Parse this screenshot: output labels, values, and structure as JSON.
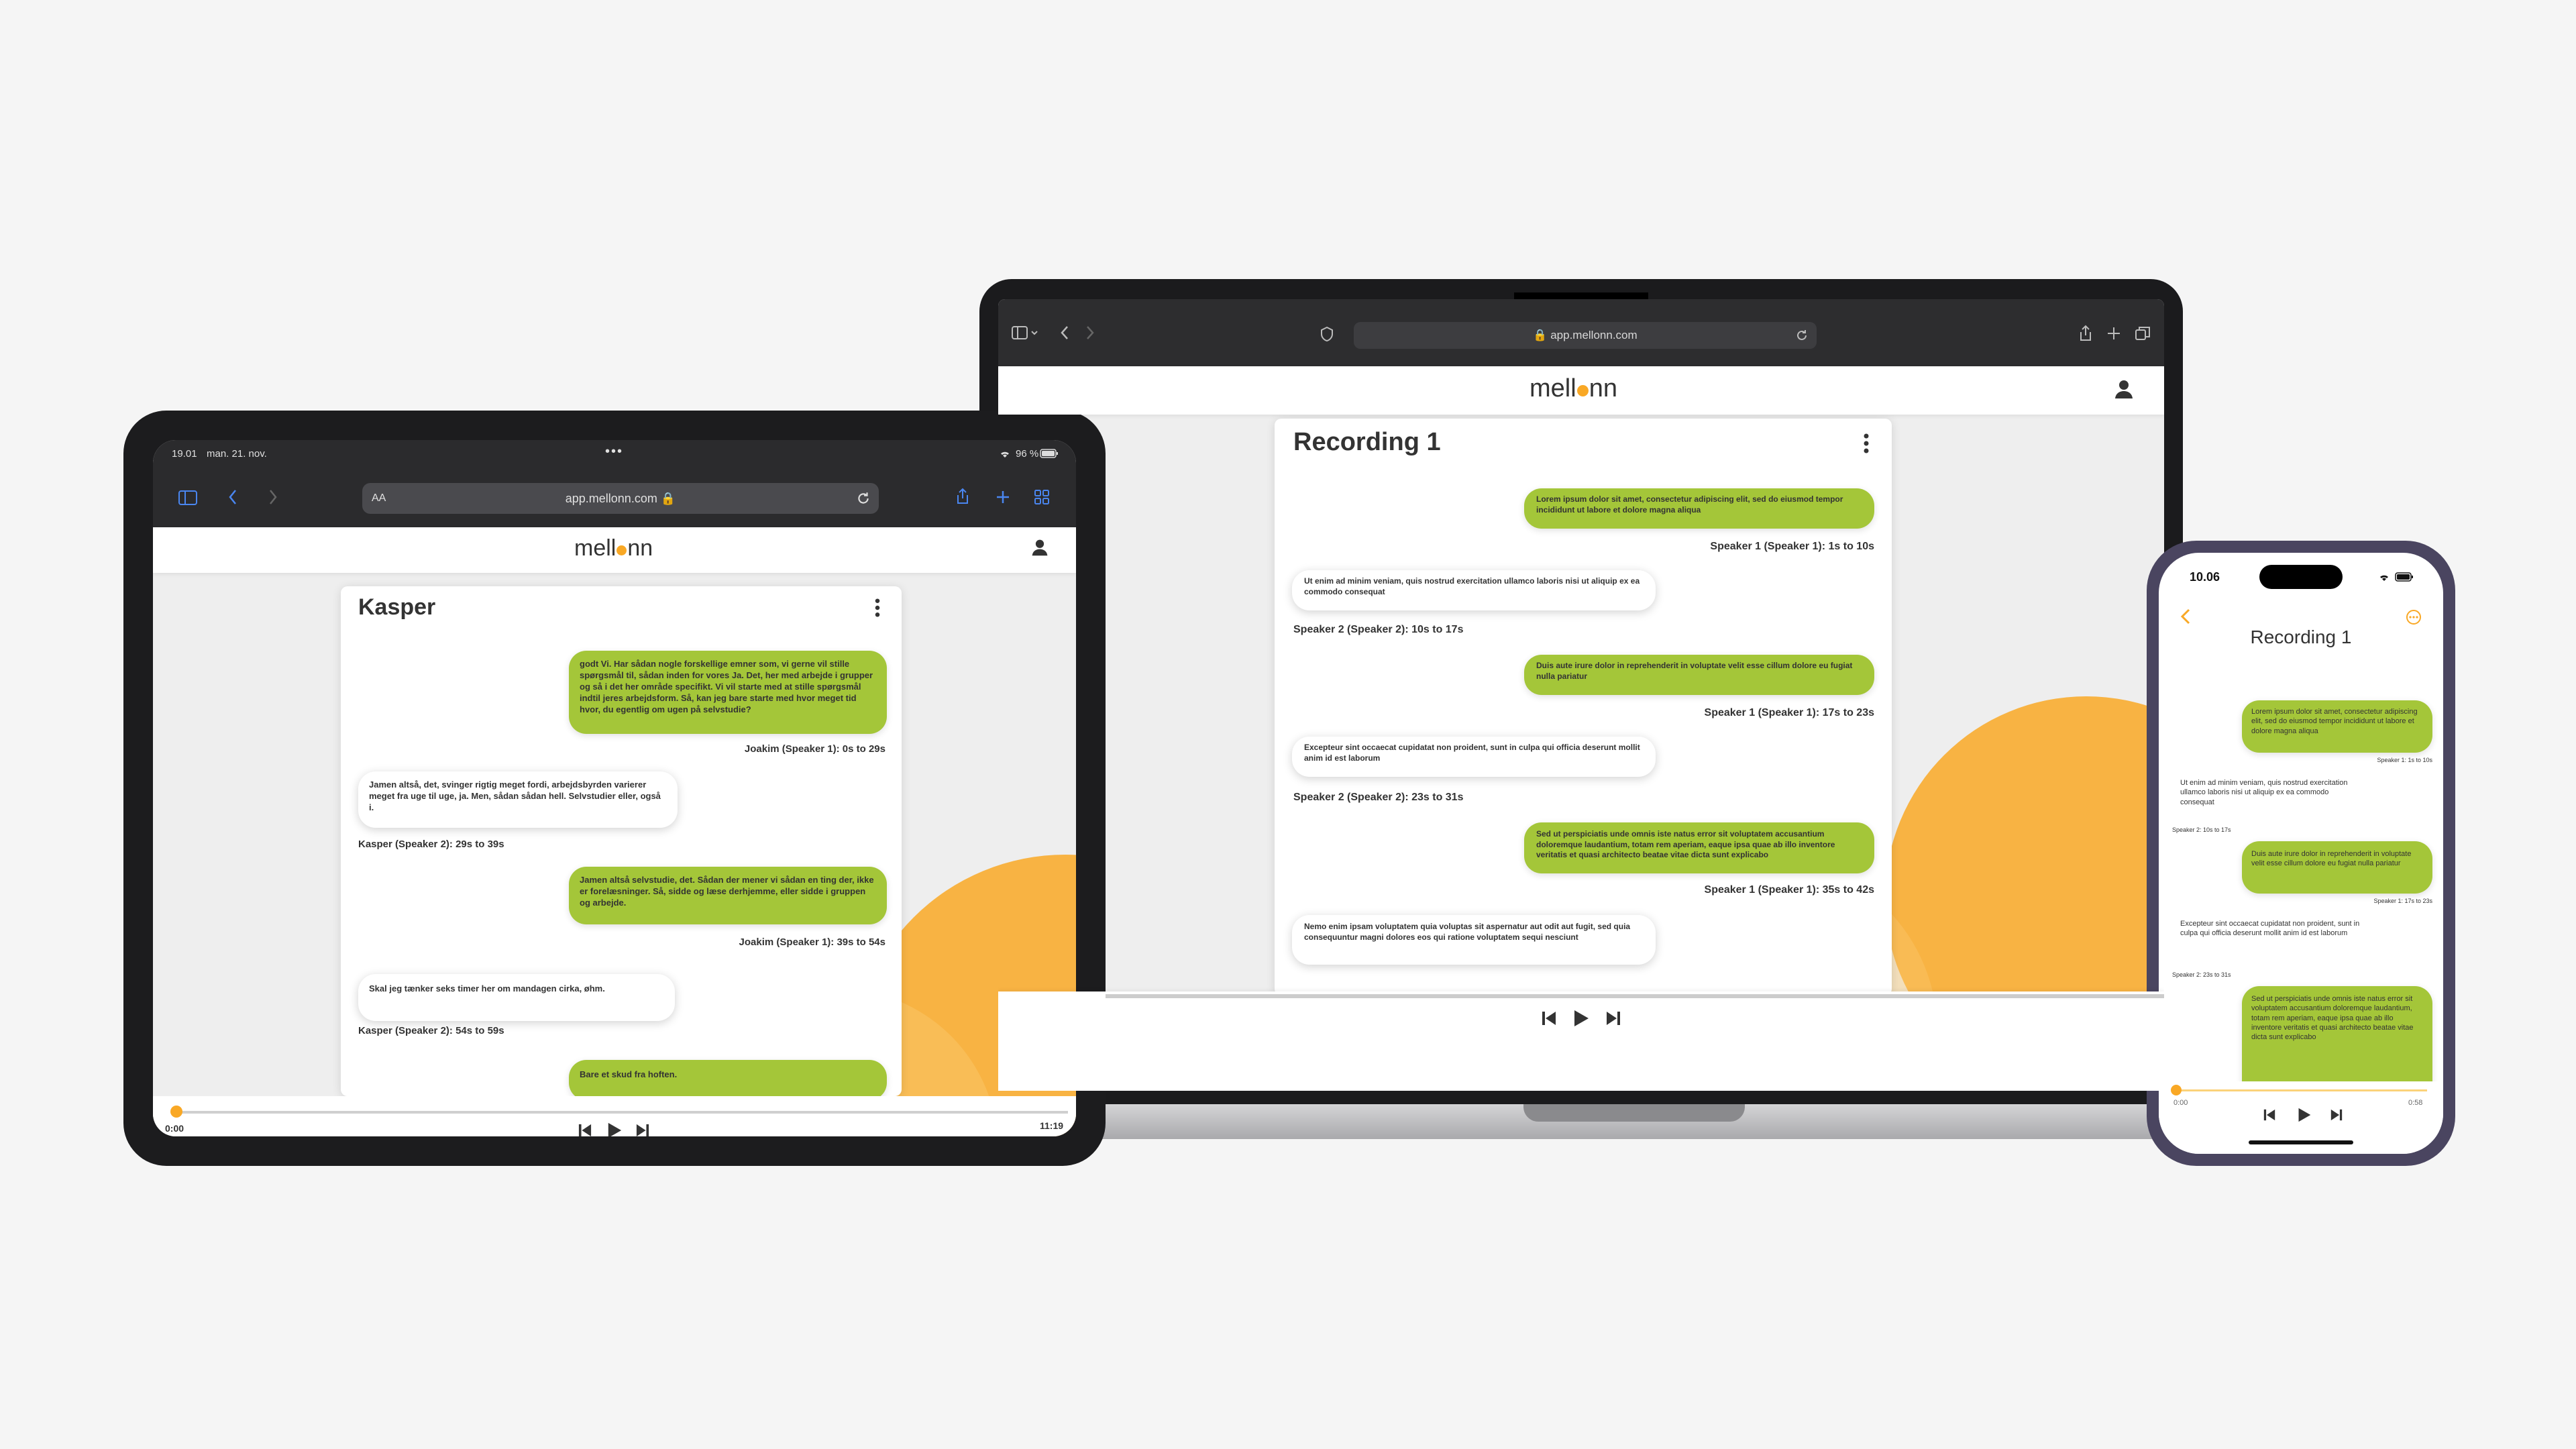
{
  "brand": {
    "name_prefix": "mell",
    "name_suffix": "nn",
    "green": "#a4c639",
    "orange": "#f9a825",
    "dark": "#333333"
  },
  "laptop": {
    "url": "app.mellonn.com",
    "title": "Recording 1",
    "messages": [
      {
        "side": "right",
        "text": "Lorem ipsum dolor sit amet, consectetur adipiscing elit, sed do eiusmod tempor incididunt ut labore et dolore magna aliqua",
        "speaker": "Speaker 1 (Speaker 1): 1s to 10s"
      },
      {
        "side": "left",
        "text": "Ut enim ad minim veniam, quis nostrud exercitation ullamco laboris nisi ut aliquip ex ea commodo consequat",
        "speaker": "Speaker 2 (Speaker 2): 10s to 17s"
      },
      {
        "side": "right",
        "text": "Duis aute irure dolor in reprehenderit in voluptate velit esse cillum dolore eu fugiat nulla pariatur",
        "speaker": "Speaker 1 (Speaker 1): 17s to 23s"
      },
      {
        "side": "left",
        "text": "Excepteur sint occaecat cupidatat non proident, sunt in culpa qui officia deserunt mollit anim id est laborum",
        "speaker": "Speaker 2 (Speaker 2): 23s to 31s"
      },
      {
        "side": "right",
        "text": "Sed ut perspiciatis unde omnis iste natus error sit voluptatem accusantium doloremque laudantium, totam rem aperiam, eaque ipsa quae ab illo inventore veritatis et quasi architecto beatae vitae dicta sunt explicabo",
        "speaker": "Speaker 1 (Speaker 1): 35s to 42s"
      },
      {
        "side": "left",
        "text": "Nemo enim ipsam voluptatem quia voluptas sit aspernatur aut odit aut fugit, sed quia consequuntur magni dolores eos qui ratione voluptatem sequi nesciunt",
        "speaker": ""
      }
    ]
  },
  "tablet": {
    "time": "19.01",
    "date": "man. 21. nov.",
    "battery": "96 %",
    "text_size": "AA",
    "url": "app.mellonn.com",
    "title": "Kasper",
    "messages": [
      {
        "side": "right",
        "text": "godt Vi. Har sådan nogle forskellige emner som, vi gerne vil stille spørgsmål til, sådan inden for vores Ja. Det, her med arbejde i grupper og så i det her område specifikt. Vi vil starte med at stille spørgsmål indtil jeres arbejdsform. Så, kan jeg bare starte med hvor meget tid hvor, du egentlig om ugen på selvstudie?",
        "speaker": "Joakim (Speaker 1): 0s to 29s"
      },
      {
        "side": "left",
        "text": "Jamen altså, det, svinger rigtig meget fordi, arbejdsbyrden varierer meget fra uge til uge, ja. Men, sådan sådan hell. Selvstudier eller, også i.",
        "speaker": "Kasper (Speaker 2): 29s to 39s"
      },
      {
        "side": "right",
        "text": "Jamen altså selvstudie, det. Sådan der mener vi sådan en ting der, ikke er forelæsninger. Så, sidde og læse derhjemme, eller sidde i gruppen og arbejde.",
        "speaker": "Joakim (Speaker 1): 39s to 54s"
      },
      {
        "side": "left",
        "text": "Skal jeg tænker seks timer her om mandagen cirka, øhm.",
        "speaker": "Kasper (Speaker 2): 54s to 59s"
      },
      {
        "side": "right",
        "text": "Bare et skud fra hoften.",
        "speaker": ""
      }
    ],
    "player": {
      "current": "0:00",
      "total": "11:19",
      "progress": 0.0
    }
  },
  "phone": {
    "time": "10.06",
    "title": "Recording 1",
    "messages": [
      {
        "side": "right",
        "text": "Lorem ipsum dolor sit amet, consectetur adipiscing elit, sed do eiusmod tempor incididunt ut labore et dolore magna aliqua",
        "speaker": "Speaker 1: 1s to 10s"
      },
      {
        "side": "left",
        "text": "Ut enim ad minim veniam, quis nostrud exercitation ullamco laboris nisi ut aliquip ex ea commodo consequat",
        "speaker": "Speaker 2: 10s to 17s"
      },
      {
        "side": "right",
        "text": "Duis aute irure dolor in reprehenderit in voluptate velit esse cillum dolore eu fugiat nulla pariatur",
        "speaker": "Speaker 1: 17s to 23s"
      },
      {
        "side": "left",
        "text": "Excepteur sint occaecat cupidatat non proident, sunt in culpa qui officia deserunt mollit anim id est laborum",
        "speaker": "Speaker 2: 23s to 31s"
      },
      {
        "side": "right",
        "text": "Sed ut perspiciatis unde omnis iste natus error sit voluptatem accusantium doloremque laudantium, totam rem aperiam, eaque ipsa quae ab illo inventore veritatis et quasi architecto beatae vitae dicta sunt explicabo",
        "speaker": ""
      }
    ],
    "player": {
      "current": "0:00",
      "total": "0:58",
      "progress": 0.0
    }
  },
  "icons": [
    "sidebar-icon",
    "back-icon",
    "forward-icon",
    "share-icon",
    "plus-icon",
    "tabs-icon",
    "reload-icon",
    "user-icon",
    "more-vertical-icon",
    "skip-back-icon",
    "play-icon",
    "skip-forward-icon",
    "wifi-icon",
    "battery-icon",
    "chevron-left-icon",
    "more-circle-icon",
    "lock-icon",
    "shield-icon"
  ]
}
